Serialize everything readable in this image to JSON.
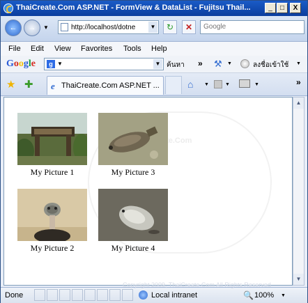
{
  "window": {
    "title": "ThaiCreate.Com ASP.NET - FormView & DataList - Fujitsu Thail...",
    "controls": [
      "_",
      "□",
      "X"
    ]
  },
  "address": {
    "url": "http://localhost/dotne",
    "search_placeholder": "Google"
  },
  "menu": [
    "File",
    "Edit",
    "View",
    "Favorites",
    "Tools",
    "Help"
  ],
  "google_bar": {
    "logo": [
      "G",
      "o",
      "o",
      "g",
      "l",
      "e"
    ],
    "logo_colors": [
      "#2a5bd7",
      "#d62d20",
      "#f4c20d",
      "#2a5bd7",
      "#1e9a3e",
      "#d62d20"
    ],
    "search_label": "ค้นหา",
    "sign_in": "ลงชื่อเข้าใช้"
  },
  "tab": {
    "title": "ThaiCreate.Com ASP.NET ..."
  },
  "gallery": [
    {
      "caption": "My Picture 1",
      "image": "sign-photo"
    },
    {
      "caption": "My Picture 3",
      "image": "fish-photo"
    },
    {
      "caption": "My Picture 2",
      "image": "ostrich-photo"
    },
    {
      "caption": "My Picture 4",
      "image": "seal-photo"
    }
  ],
  "watermark": {
    "line1": "ThaiCreate.Com",
    "line2": "Copyright 2009, ThaiCreate.Com All Rights Reserved"
  },
  "status": {
    "text": "Done",
    "zone": "Local intranet",
    "zoom": "100%"
  }
}
